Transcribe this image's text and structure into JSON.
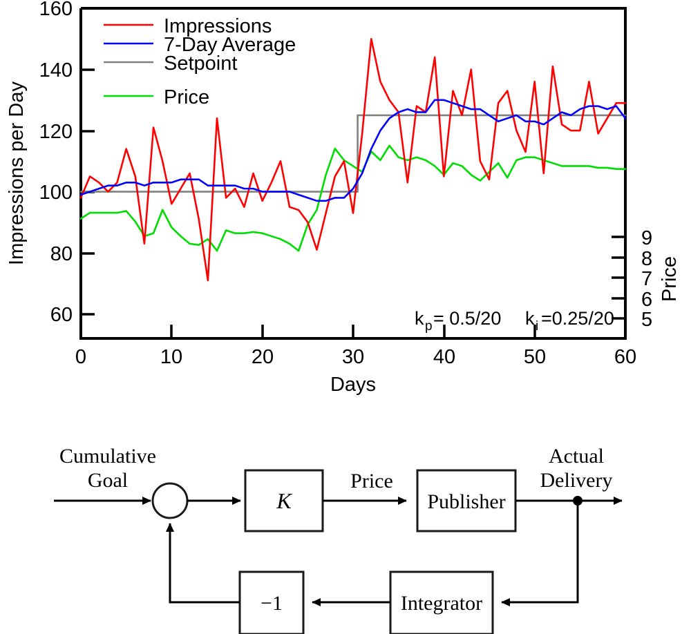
{
  "chart_data": {
    "type": "line",
    "title": "",
    "xlabel": "Days",
    "ylabel": "Impressions per Day",
    "y2label": "Price",
    "xlim": [
      0,
      60
    ],
    "ylim": [
      52,
      160
    ],
    "y2lim": [
      4.1,
      9.75
    ],
    "xticks": [
      0,
      10,
      20,
      30,
      40,
      50,
      60
    ],
    "yticks": [
      60,
      80,
      100,
      120,
      140,
      160
    ],
    "y2ticks": [
      5,
      6,
      7,
      8,
      9
    ],
    "grid": false,
    "legend_position": "top-left",
    "annotations": [
      {
        "text_kp": "k",
        "sub_kp": "p",
        "rest_kp": " = 0.5/20",
        "text_ki": "k",
        "sub_ki": "i",
        "rest_ki": "=0.25/20"
      }
    ],
    "annotation_kp": "k",
    "annotation_kp_sub": "p",
    "annotation_kp_rest": "= 0.5/20",
    "annotation_ki": "k",
    "annotation_ki_sub": "i",
    "annotation_ki_rest": "=0.25/20",
    "colors": {
      "impressions": "#ff0000",
      "average": "#0000ff",
      "setpoint": "#808080",
      "price": "#00dd00"
    },
    "legend": [
      {
        "label": "Impressions",
        "color": "#ff0000",
        "series": "impressions"
      },
      {
        "label": "7-Day Average",
        "color": "#0000ff",
        "series": "average"
      },
      {
        "label": "Setpoint",
        "color": "#808080",
        "series": "setpoint"
      },
      {
        "label": "Price",
        "color": "#00dd00",
        "series": "price"
      }
    ],
    "x": [
      0,
      1,
      2,
      3,
      4,
      5,
      6,
      7,
      8,
      9,
      10,
      11,
      12,
      13,
      14,
      15,
      16,
      17,
      18,
      19,
      20,
      21,
      22,
      23,
      24,
      25,
      26,
      27,
      28,
      29,
      30,
      31,
      32,
      33,
      34,
      35,
      36,
      37,
      38,
      39,
      40,
      41,
      42,
      43,
      44,
      45,
      46,
      47,
      48,
      49,
      50,
      51,
      52,
      53,
      54,
      55,
      56,
      57,
      58,
      59,
      60
    ],
    "series": [
      {
        "name": "Impressions",
        "axis": "left",
        "color": "#ff0000",
        "values": [
          98,
          105,
          103,
          100,
          103,
          114,
          105,
          83,
          121,
          110,
          96,
          101,
          106,
          91,
          71,
          124,
          98,
          101,
          95,
          106,
          97,
          103,
          110,
          95,
          94,
          90,
          81,
          93,
          105,
          110,
          93,
          119,
          150,
          136,
          130,
          126,
          103,
          128,
          126,
          144,
          105,
          133,
          125,
          140,
          110,
          104,
          129,
          133,
          120,
          113,
          136,
          106,
          141,
          122,
          120,
          120,
          136,
          119,
          124,
          129,
          129
        ]
      },
      {
        "name": "7-Day Average",
        "axis": "left",
        "color": "#0000ff",
        "values": [
          99,
          100,
          101,
          102,
          102,
          103,
          103,
          102,
          103,
          103,
          103,
          104,
          104,
          104,
          102,
          102,
          102,
          102,
          101,
          101,
          100,
          100,
          100,
          100,
          99,
          98,
          97,
          97,
          98,
          98,
          101,
          106,
          114,
          120,
          124,
          126,
          127,
          126,
          126,
          130,
          130,
          129,
          128,
          127,
          127,
          125,
          123,
          124,
          125,
          123,
          123,
          122,
          124,
          126,
          125,
          127,
          128,
          128,
          127,
          128,
          124
        ]
      },
      {
        "name": "Setpoint",
        "axis": "left",
        "color": "#808080",
        "values": [
          100,
          100,
          100,
          100,
          100,
          100,
          100,
          100,
          100,
          100,
          100,
          100,
          100,
          100,
          100,
          100,
          100,
          100,
          100,
          100,
          100,
          100,
          100,
          100,
          100,
          100,
          100,
          100,
          100,
          100,
          100,
          125,
          125,
          125,
          125,
          125,
          125,
          125,
          125,
          125,
          125,
          125,
          125,
          125,
          125,
          125,
          125,
          125,
          125,
          125,
          125,
          125,
          125,
          125,
          125,
          125,
          125,
          125,
          125,
          125,
          125
        ]
      },
      {
        "name": "Price",
        "axis": "right",
        "color": "#00dd00",
        "values": [
          6.15,
          6.25,
          6.25,
          6.25,
          6.25,
          6.28,
          6.1,
          5.85,
          5.9,
          6.3,
          6.0,
          5.85,
          5.72,
          5.7,
          5.8,
          5.6,
          5.95,
          5.9,
          5.9,
          5.92,
          5.9,
          5.85,
          5.8,
          5.72,
          5.6,
          6.05,
          6.3,
          6.9,
          7.35,
          7.15,
          7.05,
          6.95,
          7.3,
          7.15,
          7.4,
          7.2,
          7.15,
          7.2,
          7.15,
          7.05,
          6.9,
          7.1,
          7.05,
          6.9,
          6.8,
          6.95,
          7.1,
          6.85,
          7.15,
          7.2,
          7.2,
          7.15,
          7.1,
          7.05,
          7.05,
          7.05,
          7.05,
          7.02,
          7.02,
          7.0,
          7.0
        ]
      }
    ]
  },
  "diagram": {
    "name": "feedback-control-block-diagram",
    "labels": {
      "input_line1": "Cumulative",
      "input_line2": "Goal",
      "gain_block": "K",
      "price_label": "Price",
      "publisher_block": "Publisher",
      "output_line1": "Actual",
      "output_line2": "Delivery",
      "negate_block": "−1",
      "integrator_block": "Integrator"
    }
  }
}
